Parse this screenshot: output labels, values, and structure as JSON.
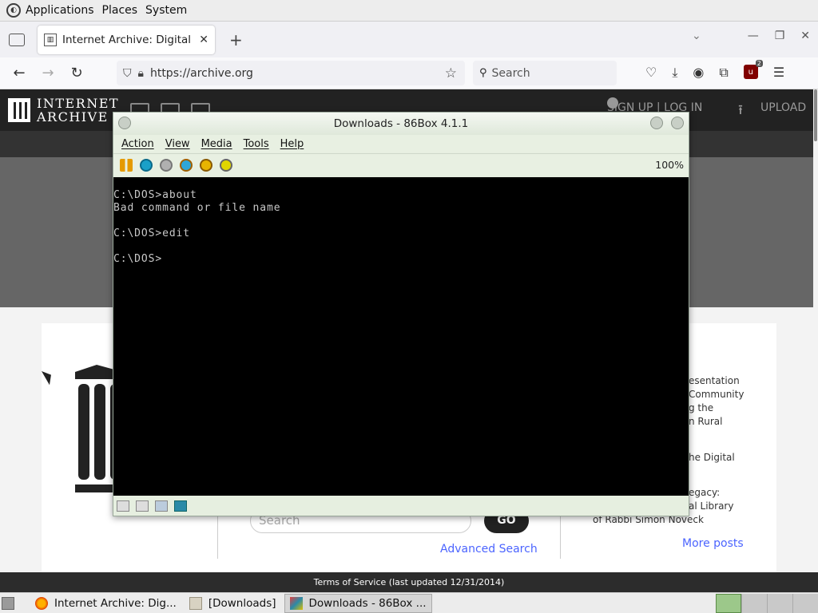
{
  "top_panel": {
    "menus": [
      "Applications",
      "Places",
      "System"
    ]
  },
  "browser": {
    "tab_title": "Internet Archive: Digital Libr",
    "tab_close": "✕",
    "new_tab": "+",
    "url": "https://archive.org",
    "search_placeholder": "Search",
    "extension_badge": "2"
  },
  "page": {
    "logo_line1": "INTERNET",
    "logo_line2": "ARCHIVE",
    "signup": "SIGN UP | LOG IN",
    "upload": "UPLOAD",
    "search_placeholder": "Search",
    "go_button": "GO",
    "advanced_search": "Advanced Search",
    "posts": [
      "esentation",
      "Community",
      "g the",
      "n Rural",
      "he Digital",
      "egacy:",
      "al Library",
      "of Rabbi Simon Noveck"
    ],
    "more_posts": "More posts",
    "footer": "Terms of Service (last updated 12/31/2014)"
  },
  "vm_window": {
    "title": "Downloads - 86Box 4.1.1",
    "menus": [
      "Action",
      "View",
      "Media",
      "Tools",
      "Help"
    ],
    "zoom": "100%",
    "console_lines": [
      "C:\\DOS>about",
      "Bad command or file name",
      "",
      "C:\\DOS>edit",
      "",
      "C:\\DOS>"
    ]
  },
  "taskbar": {
    "items": [
      "Internet Archive: Dig...",
      "[Downloads]",
      "Downloads - 86Box ..."
    ]
  }
}
